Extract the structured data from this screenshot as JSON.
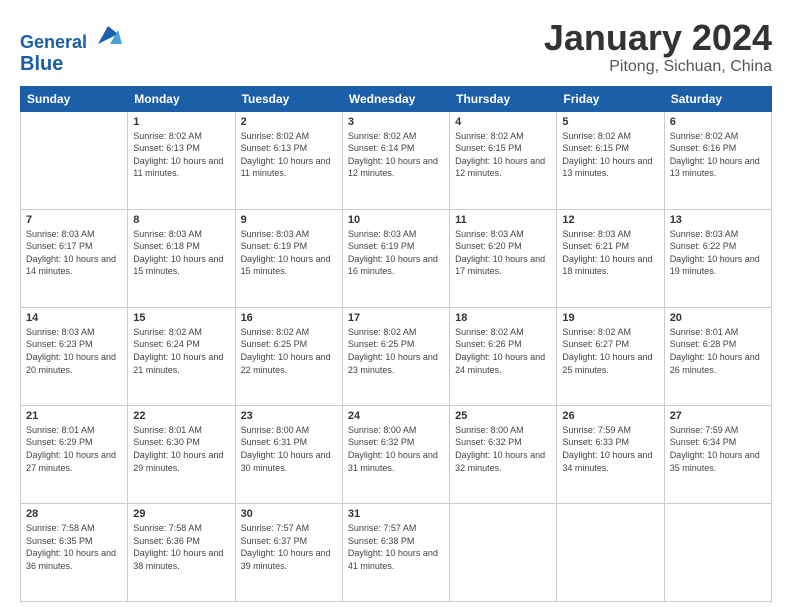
{
  "header": {
    "logo_line1": "General",
    "logo_line2": "Blue",
    "month_title": "January 2024",
    "location": "Pitong, Sichuan, China"
  },
  "columns": [
    "Sunday",
    "Monday",
    "Tuesday",
    "Wednesday",
    "Thursday",
    "Friday",
    "Saturday"
  ],
  "weeks": [
    [
      {
        "day": "",
        "sunrise": "",
        "sunset": "",
        "daylight": ""
      },
      {
        "day": "1",
        "sunrise": "Sunrise: 8:02 AM",
        "sunset": "Sunset: 6:13 PM",
        "daylight": "Daylight: 10 hours and 11 minutes."
      },
      {
        "day": "2",
        "sunrise": "Sunrise: 8:02 AM",
        "sunset": "Sunset: 6:13 PM",
        "daylight": "Daylight: 10 hours and 11 minutes."
      },
      {
        "day": "3",
        "sunrise": "Sunrise: 8:02 AM",
        "sunset": "Sunset: 6:14 PM",
        "daylight": "Daylight: 10 hours and 12 minutes."
      },
      {
        "day": "4",
        "sunrise": "Sunrise: 8:02 AM",
        "sunset": "Sunset: 6:15 PM",
        "daylight": "Daylight: 10 hours and 12 minutes."
      },
      {
        "day": "5",
        "sunrise": "Sunrise: 8:02 AM",
        "sunset": "Sunset: 6:15 PM",
        "daylight": "Daylight: 10 hours and 13 minutes."
      },
      {
        "day": "6",
        "sunrise": "Sunrise: 8:02 AM",
        "sunset": "Sunset: 6:16 PM",
        "daylight": "Daylight: 10 hours and 13 minutes."
      }
    ],
    [
      {
        "day": "7",
        "sunrise": "Sunrise: 8:03 AM",
        "sunset": "Sunset: 6:17 PM",
        "daylight": "Daylight: 10 hours and 14 minutes."
      },
      {
        "day": "8",
        "sunrise": "Sunrise: 8:03 AM",
        "sunset": "Sunset: 6:18 PM",
        "daylight": "Daylight: 10 hours and 15 minutes."
      },
      {
        "day": "9",
        "sunrise": "Sunrise: 8:03 AM",
        "sunset": "Sunset: 6:19 PM",
        "daylight": "Daylight: 10 hours and 15 minutes."
      },
      {
        "day": "10",
        "sunrise": "Sunrise: 8:03 AM",
        "sunset": "Sunset: 6:19 PM",
        "daylight": "Daylight: 10 hours and 16 minutes."
      },
      {
        "day": "11",
        "sunrise": "Sunrise: 8:03 AM",
        "sunset": "Sunset: 6:20 PM",
        "daylight": "Daylight: 10 hours and 17 minutes."
      },
      {
        "day": "12",
        "sunrise": "Sunrise: 8:03 AM",
        "sunset": "Sunset: 6:21 PM",
        "daylight": "Daylight: 10 hours and 18 minutes."
      },
      {
        "day": "13",
        "sunrise": "Sunrise: 8:03 AM",
        "sunset": "Sunset: 6:22 PM",
        "daylight": "Daylight: 10 hours and 19 minutes."
      }
    ],
    [
      {
        "day": "14",
        "sunrise": "Sunrise: 8:03 AM",
        "sunset": "Sunset: 6:23 PM",
        "daylight": "Daylight: 10 hours and 20 minutes."
      },
      {
        "day": "15",
        "sunrise": "Sunrise: 8:02 AM",
        "sunset": "Sunset: 6:24 PM",
        "daylight": "Daylight: 10 hours and 21 minutes."
      },
      {
        "day": "16",
        "sunrise": "Sunrise: 8:02 AM",
        "sunset": "Sunset: 6:25 PM",
        "daylight": "Daylight: 10 hours and 22 minutes."
      },
      {
        "day": "17",
        "sunrise": "Sunrise: 8:02 AM",
        "sunset": "Sunset: 6:25 PM",
        "daylight": "Daylight: 10 hours and 23 minutes."
      },
      {
        "day": "18",
        "sunrise": "Sunrise: 8:02 AM",
        "sunset": "Sunset: 6:26 PM",
        "daylight": "Daylight: 10 hours and 24 minutes."
      },
      {
        "day": "19",
        "sunrise": "Sunrise: 8:02 AM",
        "sunset": "Sunset: 6:27 PM",
        "daylight": "Daylight: 10 hours and 25 minutes."
      },
      {
        "day": "20",
        "sunrise": "Sunrise: 8:01 AM",
        "sunset": "Sunset: 6:28 PM",
        "daylight": "Daylight: 10 hours and 26 minutes."
      }
    ],
    [
      {
        "day": "21",
        "sunrise": "Sunrise: 8:01 AM",
        "sunset": "Sunset: 6:29 PM",
        "daylight": "Daylight: 10 hours and 27 minutes."
      },
      {
        "day": "22",
        "sunrise": "Sunrise: 8:01 AM",
        "sunset": "Sunset: 6:30 PM",
        "daylight": "Daylight: 10 hours and 29 minutes."
      },
      {
        "day": "23",
        "sunrise": "Sunrise: 8:00 AM",
        "sunset": "Sunset: 6:31 PM",
        "daylight": "Daylight: 10 hours and 30 minutes."
      },
      {
        "day": "24",
        "sunrise": "Sunrise: 8:00 AM",
        "sunset": "Sunset: 6:32 PM",
        "daylight": "Daylight: 10 hours and 31 minutes."
      },
      {
        "day": "25",
        "sunrise": "Sunrise: 8:00 AM",
        "sunset": "Sunset: 6:32 PM",
        "daylight": "Daylight: 10 hours and 32 minutes."
      },
      {
        "day": "26",
        "sunrise": "Sunrise: 7:59 AM",
        "sunset": "Sunset: 6:33 PM",
        "daylight": "Daylight: 10 hours and 34 minutes."
      },
      {
        "day": "27",
        "sunrise": "Sunrise: 7:59 AM",
        "sunset": "Sunset: 6:34 PM",
        "daylight": "Daylight: 10 hours and 35 minutes."
      }
    ],
    [
      {
        "day": "28",
        "sunrise": "Sunrise: 7:58 AM",
        "sunset": "Sunset: 6:35 PM",
        "daylight": "Daylight: 10 hours and 36 minutes."
      },
      {
        "day": "29",
        "sunrise": "Sunrise: 7:58 AM",
        "sunset": "Sunset: 6:36 PM",
        "daylight": "Daylight: 10 hours and 38 minutes."
      },
      {
        "day": "30",
        "sunrise": "Sunrise: 7:57 AM",
        "sunset": "Sunset: 6:37 PM",
        "daylight": "Daylight: 10 hours and 39 minutes."
      },
      {
        "day": "31",
        "sunrise": "Sunrise: 7:57 AM",
        "sunset": "Sunset: 6:38 PM",
        "daylight": "Daylight: 10 hours and 41 minutes."
      },
      {
        "day": "",
        "sunrise": "",
        "sunset": "",
        "daylight": ""
      },
      {
        "day": "",
        "sunrise": "",
        "sunset": "",
        "daylight": ""
      },
      {
        "day": "",
        "sunrise": "",
        "sunset": "",
        "daylight": ""
      }
    ]
  ]
}
